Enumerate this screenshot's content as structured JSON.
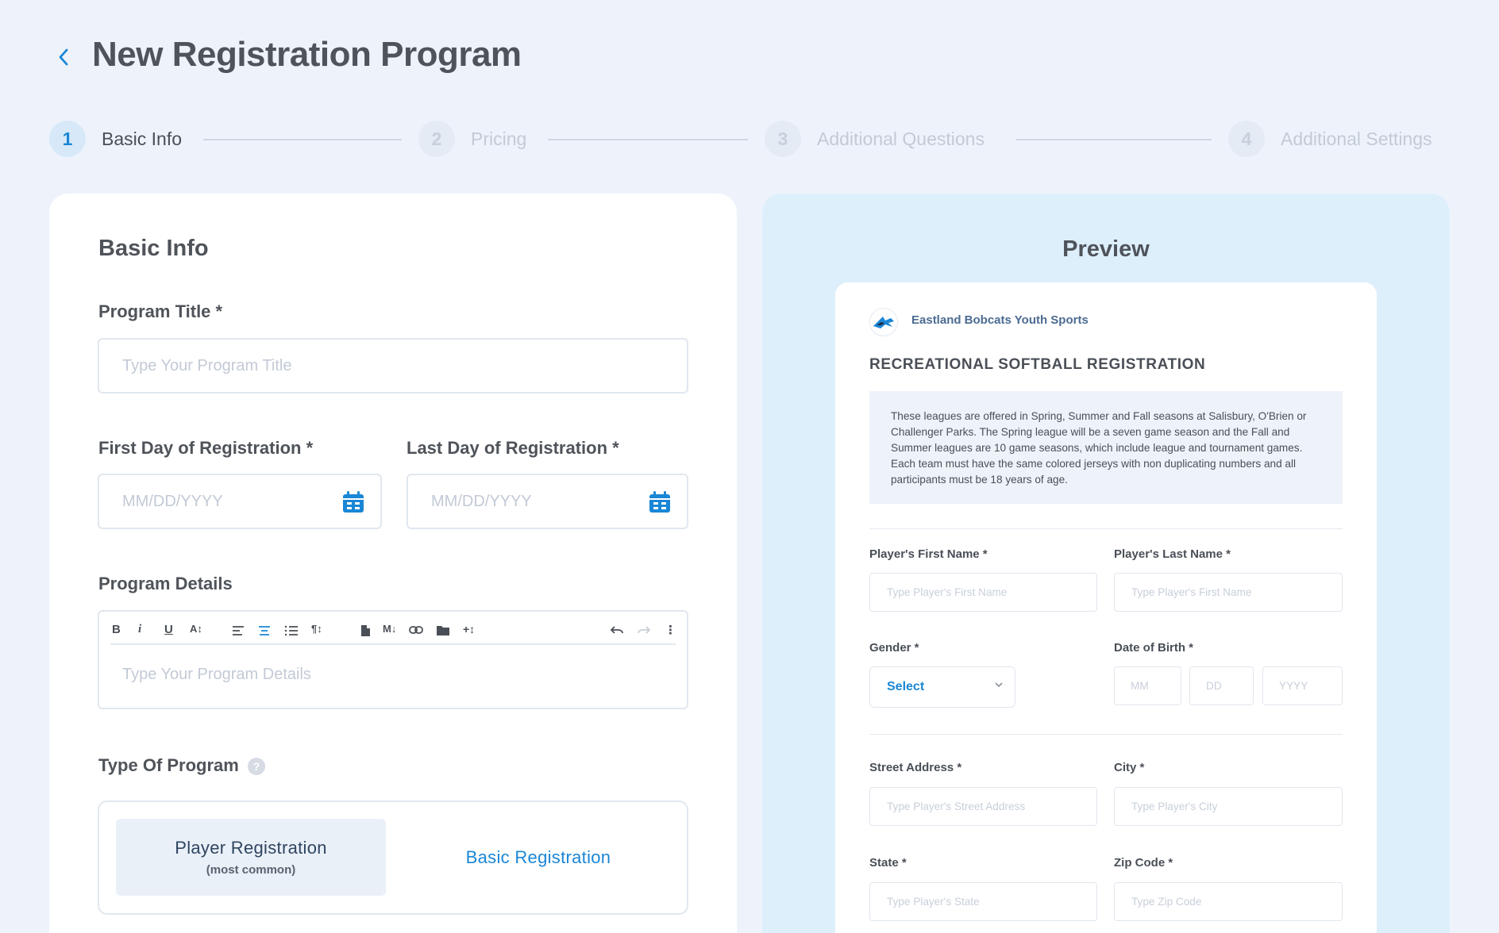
{
  "header": {
    "title": "New Registration Program"
  },
  "stepper": {
    "steps": [
      {
        "num": "1",
        "label": "Basic Info"
      },
      {
        "num": "2",
        "label": "Pricing"
      },
      {
        "num": "3",
        "label": "Additional Questions"
      },
      {
        "num": "4",
        "label": "Additional Settings"
      }
    ]
  },
  "basic_info": {
    "section_title": "Basic Info",
    "program_title_label": "Program Title *",
    "program_title_placeholder": "Type Your Program Title",
    "first_day_label": "First Day of Registration *",
    "first_day_placeholder": "MM/DD/YYYY",
    "last_day_label": "Last Day of Registration *",
    "last_day_placeholder": "MM/DD/YYYY",
    "details_label": "Program Details",
    "details_placeholder": "Type Your Program Details",
    "toolbar": {
      "bold": "B",
      "italic": "i",
      "underline": "U",
      "font_size": "A↕",
      "paragraph": "¶↕",
      "markdown": "M↓",
      "add": "+↕",
      "more": "⋮"
    },
    "type_label": "Type Of Program",
    "type_options": {
      "player_main": "Player Registration",
      "player_sub": "(most common)",
      "basic": "Basic Registration"
    }
  },
  "preview": {
    "title": "Preview",
    "org_name": "Eastland Bobcats Youth Sports",
    "form_title": "RECREATIONAL SOFTBALL REGISTRATION",
    "description": "These leagues are offered in Spring, Summer and Fall seasons at Salisbury, O'Brien or Challenger Parks. The Spring league will be a seven game season and the Fall and Summer leagues are 10 game seasons, which include league and tournament games. Each team must have the same colored jerseys with non duplicating numbers and all participants must be 18 years of age.",
    "first_name_label": "Player's First Name *",
    "first_name_placeholder": "Type Player's First Name",
    "last_name_label": "Player's Last Name *",
    "last_name_placeholder": "Type Player's First Name",
    "gender_label": "Gender *",
    "gender_value": "Select",
    "dob_label": "Date of Birth *",
    "dob_mm": "MM",
    "dob_dd": "DD",
    "dob_yyyy": "YYYY",
    "street_label": "Street Address *",
    "street_placeholder": "Type Player's Street Address",
    "city_label": "City *",
    "city_placeholder": "Type Player's City",
    "state_label": "State *",
    "state_placeholder": "Type Player's State",
    "zip_label": "Zip Code *",
    "zip_placeholder": "Type Zip Code"
  },
  "colors": {
    "accent": "#1a86d6",
    "background": "#eef3fb",
    "preview_bg": "#deeffc"
  }
}
